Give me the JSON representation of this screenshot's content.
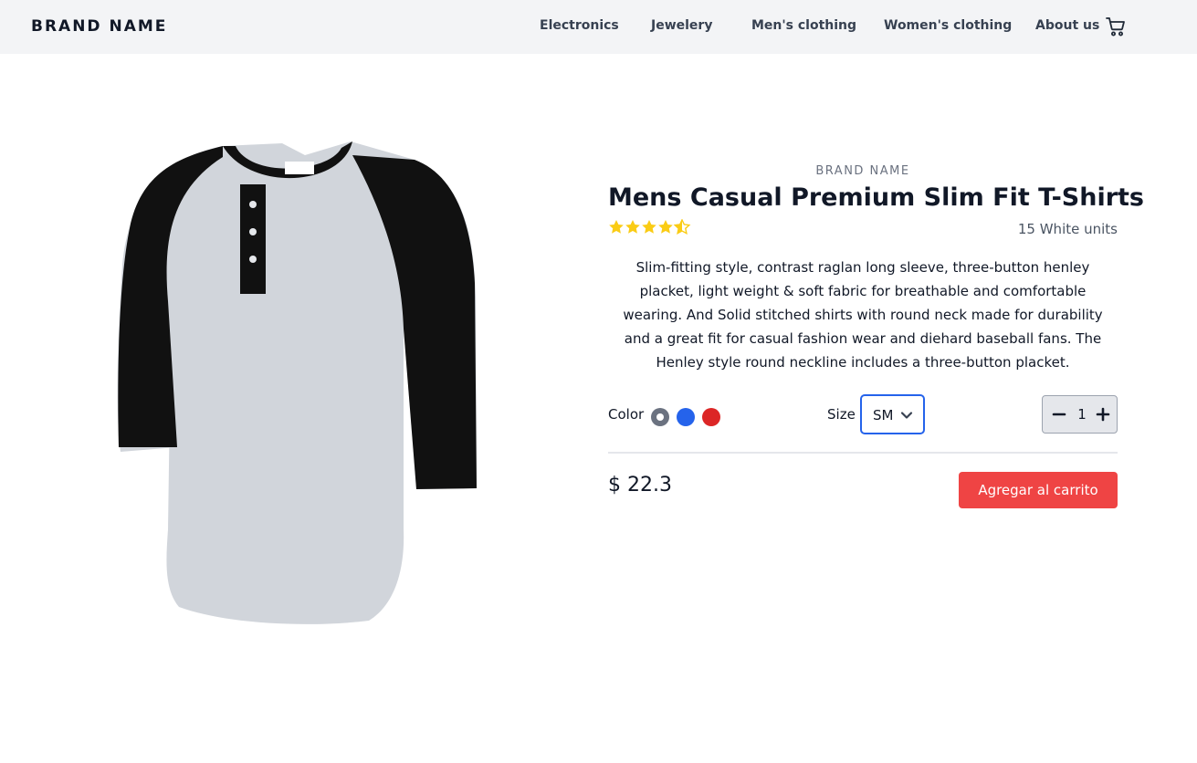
{
  "nav": {
    "brand": "BRAND NAME",
    "links": [
      "Electronics",
      "Jewelery",
      "Men's clothing",
      "Women's clothing",
      "About us"
    ]
  },
  "product": {
    "brand": "BRAND NAME",
    "title": "Mens Casual Premium Slim Fit T-Shirts",
    "rating": 4.5,
    "rating_max": 5,
    "units": "15 White units",
    "description": "Slim-fitting style, contrast raglan long sleeve, three-button henley placket, light weight & soft fabric for breathable and comfortable wearing. And Solid stitched shirts with round neck made for durability and a great fit for casual fashion wear and diehard baseball fans. The Henley style round neckline includes a three-button placket.",
    "color_label": "Color",
    "colors": [
      "#6b7280",
      "#2563eb",
      "#dc2626"
    ],
    "selected_color": "#6b7280",
    "size_label": "Size",
    "size_value": "SM",
    "quantity": "1",
    "price": "$ 22.3",
    "add_to_cart_label": "Agregar al carrito"
  },
  "colors": {
    "accent": "#ef4444",
    "focus": "#2563eb",
    "star": "#facc15"
  },
  "icons": {
    "cart": "cart-icon",
    "chevron": "chevron-down-icon",
    "minus": "minus-icon",
    "plus": "plus-icon",
    "star": "star-icon"
  }
}
